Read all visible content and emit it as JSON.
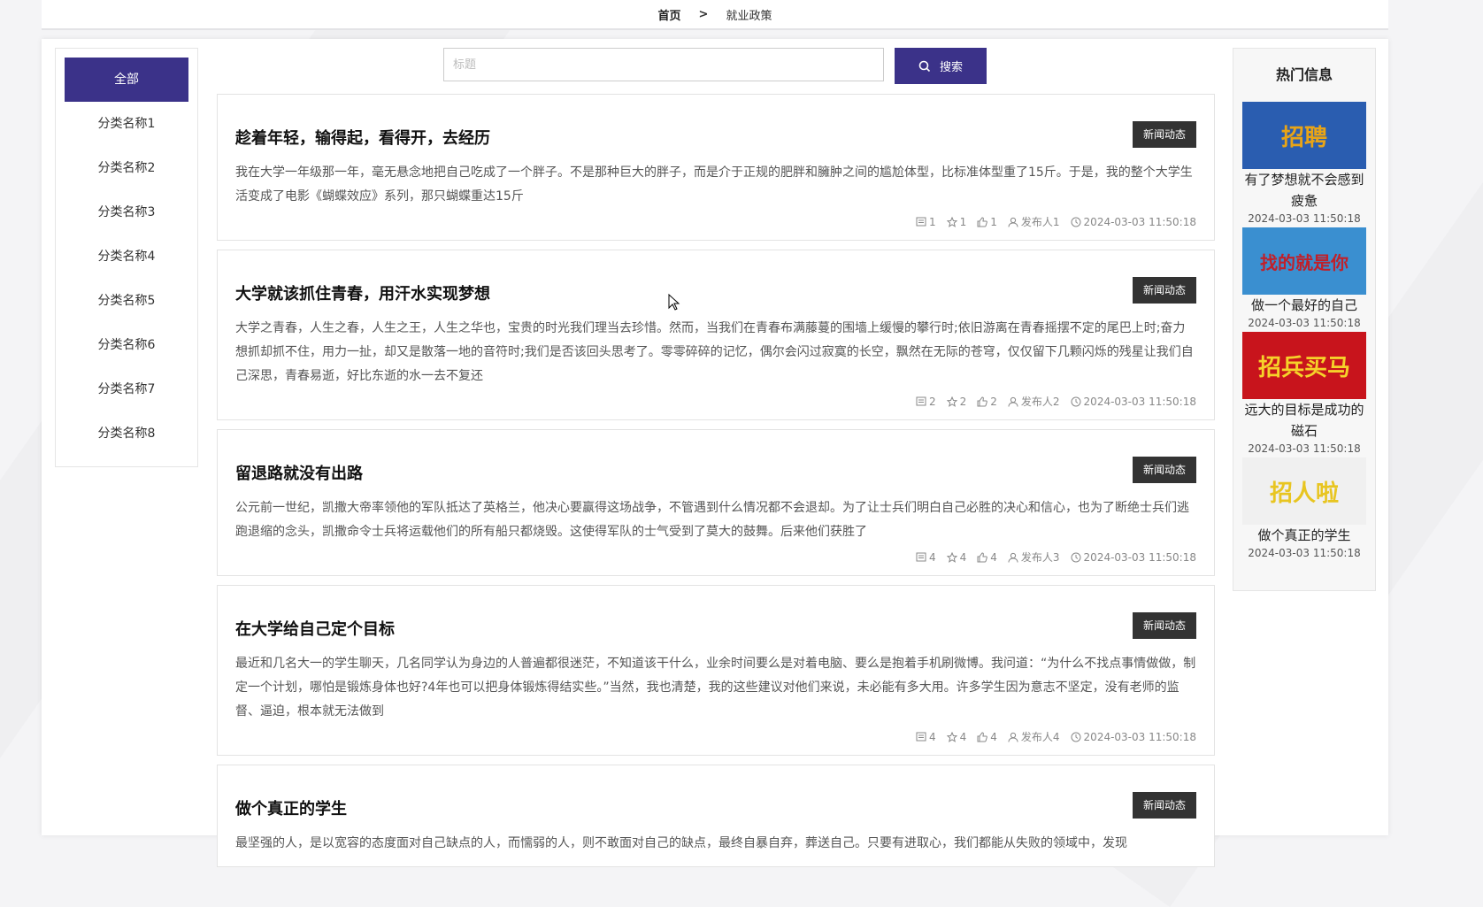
{
  "breadcrumb": {
    "home": "首页",
    "separator": ">",
    "current": "就业政策"
  },
  "sidebar": {
    "items": [
      {
        "label": "全部",
        "active": true
      },
      {
        "label": "分类名称1"
      },
      {
        "label": "分类名称2"
      },
      {
        "label": "分类名称3"
      },
      {
        "label": "分类名称4"
      },
      {
        "label": "分类名称5"
      },
      {
        "label": "分类名称6"
      },
      {
        "label": "分类名称7"
      },
      {
        "label": "分类名称8"
      }
    ]
  },
  "search": {
    "placeholder": "标题",
    "button_label": "搜索"
  },
  "articles": [
    {
      "title": "趁着年轻，输得起，看得开，去经历",
      "tag": "新闻动态",
      "summary": "我在大学一年级那一年，毫无悬念地把自己吃成了一个胖子。不是那种巨大的胖子，而是介于正规的肥胖和臃肿之间的尴尬体型，比标准体型重了15斤。于是，我的整个大学生活变成了电影《蝴蝶效应》系列，那只蝴蝶重达15斤",
      "comments": "1",
      "favorites": "1",
      "likes": "1",
      "author": "发布人1",
      "time": "2024-03-03 11:50:18"
    },
    {
      "title": "大学就该抓住青春，用汗水实现梦想",
      "tag": "新闻动态",
      "summary": "大学之青春，人生之春，人生之王，人生之华也，宝贵的时光我们理当去珍惜。然而，当我们在青春布满藤蔓的围墙上缓慢的攀行时;依旧游离在青春摇摆不定的尾巴上时;奋力想抓却抓不住，用力一扯，却又是散落一地的音符时;我们是否该回头思考了。零零碎碎的记忆，偶尔会闪过寂寞的长空，飘然在无际的苍穹，仅仅留下几颗闪烁的残星让我们自己深思，青春易逝，好比东逝的水一去不复还",
      "comments": "2",
      "favorites": "2",
      "likes": "2",
      "author": "发布人2",
      "time": "2024-03-03 11:50:18"
    },
    {
      "title": "留退路就没有出路",
      "tag": "新闻动态",
      "summary": "公元前一世纪，凯撒大帝率领他的军队抵达了英格兰，他决心要赢得这场战争，不管遇到什么情况都不会退却。为了让士兵们明白自己必胜的决心和信心，也为了断绝士兵们逃跑退缩的念头，凯撒命令士兵将运载他们的所有船只都烧毁。这使得军队的士气受到了莫大的鼓舞。后来他们获胜了",
      "comments": "4",
      "favorites": "4",
      "likes": "4",
      "author": "发布人3",
      "time": "2024-03-03 11:50:18"
    },
    {
      "title": "在大学给自己定个目标",
      "tag": "新闻动态",
      "summary": "最近和几名大一的学生聊天，几名同学认为身边的人普遍都很迷茫，不知道该干什么，业余时间要么是对着电脑、要么是抱着手机刷微博。我问道：“为什么不找点事情做做，制定一个计划，哪怕是锻炼身体也好?4年也可以把身体锻炼得结实些。”当然，我也清楚，我的这些建议对他们来说，未必能有多大用。许多学生因为意志不坚定，没有老师的监督、逼迫，根本就无法做到",
      "comments": "4",
      "favorites": "4",
      "likes": "4",
      "author": "发布人4",
      "time": "2024-03-03 11:50:18"
    },
    {
      "title": "做个真正的学生",
      "tag": "新闻动态",
      "summary": "最坚强的人，是以宽容的态度面对自己缺点的人，而懦弱的人，则不敢面对自己的缺点，最终自暴自弃，葬送自己。只要有进取心，我们都能从失败的领域中，发现",
      "comments": "",
      "favorites": "",
      "likes": "",
      "author": "",
      "time": ""
    }
  ],
  "hot": {
    "title": "热门信息",
    "items": [
      {
        "name": "有了梦想就不会感到疲惫",
        "time": "2024-03-03 11:50:18",
        "image_text": "招聘",
        "image_color": "#e8a417",
        "image_bg": "#2a5db0"
      },
      {
        "name": "做一个最好的自己",
        "time": "2024-03-03 11:50:18",
        "image_text": "找的就是你",
        "image_color": "#c0202a",
        "image_bg": "#3a8fd0"
      },
      {
        "name": "远大的目标是成功的磁石",
        "time": "2024-03-03 11:50:18",
        "image_text": "招兵买马",
        "image_color": "#f6d22a",
        "image_bg": "#c8141c"
      },
      {
        "name": "做个真正的学生",
        "time": "2024-03-03 11:50:18",
        "image_text": "招人啦",
        "image_color": "#e8c520",
        "image_bg": "#f0f0f0"
      }
    ]
  },
  "colors": {
    "accent": "#3b3289",
    "tag_bg": "#333333"
  }
}
